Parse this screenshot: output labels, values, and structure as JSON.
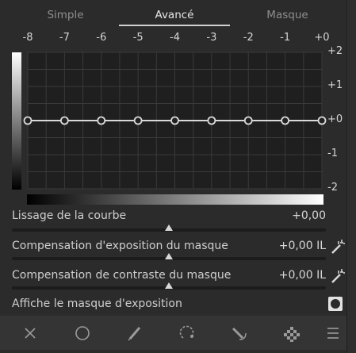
{
  "tabs": [
    {
      "label": "Simple",
      "active": false
    },
    {
      "label": "Avancé",
      "active": true
    },
    {
      "label": "Masque",
      "active": false
    }
  ],
  "curve": {
    "x_ticks": [
      "-8",
      "-7",
      "-6",
      "-5",
      "-4",
      "-3",
      "-2",
      "-1",
      "+0"
    ],
    "y_ticks": [
      "+2",
      "+1",
      "+0",
      "-1",
      "-2"
    ],
    "points": [
      {
        "x": -8,
        "y": 0
      },
      {
        "x": -7,
        "y": 0
      },
      {
        "x": -6,
        "y": 0
      },
      {
        "x": -5,
        "y": 0
      },
      {
        "x": -4,
        "y": 0
      },
      {
        "x": -3,
        "y": 0
      },
      {
        "x": -2,
        "y": 0
      },
      {
        "x": -1,
        "y": 0
      },
      {
        "x": 0,
        "y": 0
      }
    ]
  },
  "sliders": [
    {
      "label": "Lissage de la courbe",
      "value": "+0,00",
      "level": 0.5,
      "has_picker": false
    },
    {
      "label": "Compensation d'exposition du masque",
      "value": "+0,00 IL",
      "level": 0.5,
      "has_picker": true
    },
    {
      "label": "Compensation de contraste du masque",
      "value": "+0,00 IL",
      "level": 0.5,
      "has_picker": true
    }
  ],
  "mask_toggle": {
    "label": "Affiche le masque d'exposition"
  },
  "toolbar": {
    "icons": [
      "close-icon",
      "circle-icon",
      "pencil-icon",
      "drawn-path-icon",
      "paths-icon",
      "checkerboard-icon",
      "menu-icon"
    ]
  },
  "colors": {
    "background": "#2b2b2b",
    "curve": "#d9d9d9",
    "grid": "#3a3a3a"
  }
}
